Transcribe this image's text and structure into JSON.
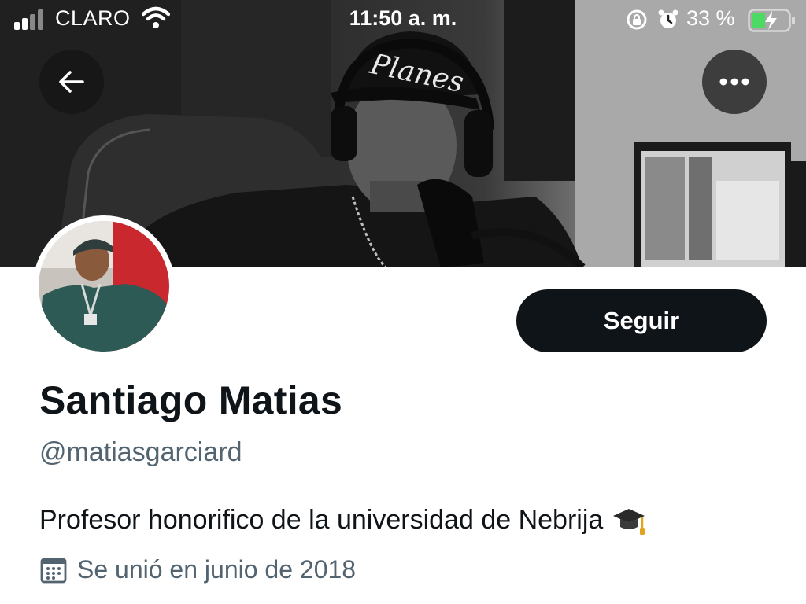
{
  "status_bar": {
    "carrier": "CLARO",
    "time": "11:50 a. m.",
    "battery_percent": "33 %",
    "icons": [
      "signal-icon",
      "wifi-icon",
      "rotation-lock-icon",
      "alarm-icon",
      "battery-charging-icon"
    ]
  },
  "banner": {
    "cap_text": "Planes"
  },
  "header": {
    "back_icon": "arrow-left-icon",
    "more_icon": "more-horizontal-icon"
  },
  "profile": {
    "follow_label": "Seguir",
    "display_name": "Santiago Matias",
    "handle": "@matiasgarciard",
    "bio": "Profesor honorifico de la universidad de Nebrija",
    "bio_emoji_icon": "graduation-cap-icon",
    "joined": "Se unió en junio de 2018",
    "joined_icon": "calendar-icon"
  },
  "colors": {
    "primary_text": "#0f1419",
    "secondary_text": "#536471",
    "button_bg": "#0f1419",
    "battery_green": "#4cd964"
  }
}
